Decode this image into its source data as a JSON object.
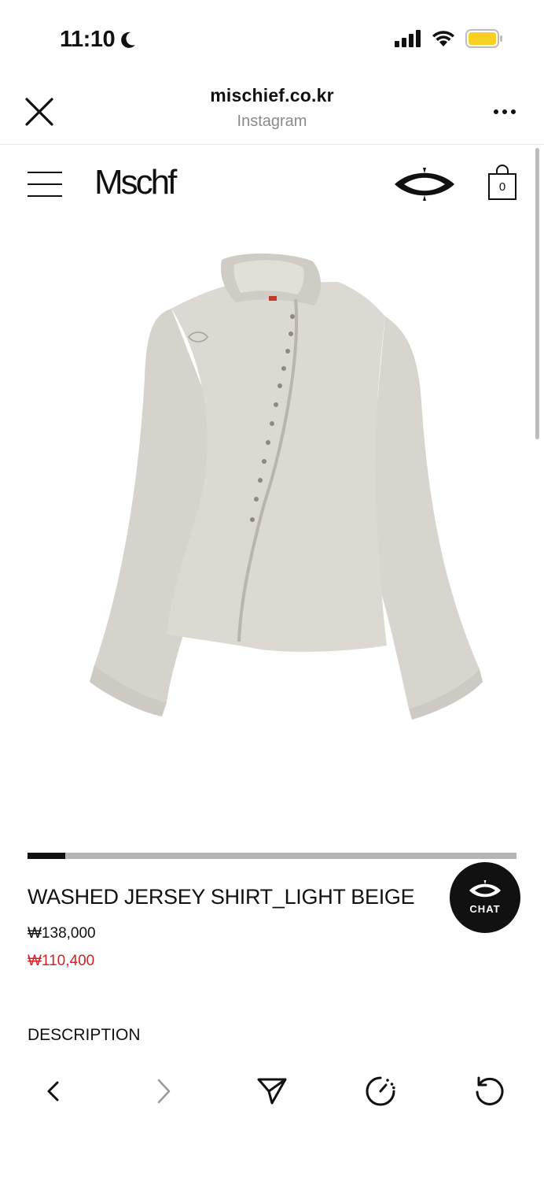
{
  "status_bar": {
    "time": "11:10",
    "battery_color": "#f7d022"
  },
  "browser": {
    "domain": "mischief.co.kr",
    "source": "Instagram"
  },
  "site": {
    "logo": "Mschf",
    "cart_count": "0"
  },
  "gallery": {
    "progress": 0.077
  },
  "product": {
    "name": "WASHED JERSEY SHIRT_LIGHT BEIGE",
    "price_original": "₩138,000",
    "price_sale": "₩110,400",
    "price_sale_color": "#d62222",
    "description_label": "DESCRIPTION"
  },
  "chat": {
    "label": "CHAT"
  },
  "icons": {
    "close": "close-icon",
    "more": "more-dots-icon",
    "menu": "hamburger-icon",
    "brand": "brand-eye-icon",
    "cart": "shopping-bag-icon",
    "back": "chevron-left-icon",
    "forward": "chevron-right-icon",
    "share": "send-icon",
    "speed": "gauge-icon",
    "reload": "reload-icon"
  }
}
